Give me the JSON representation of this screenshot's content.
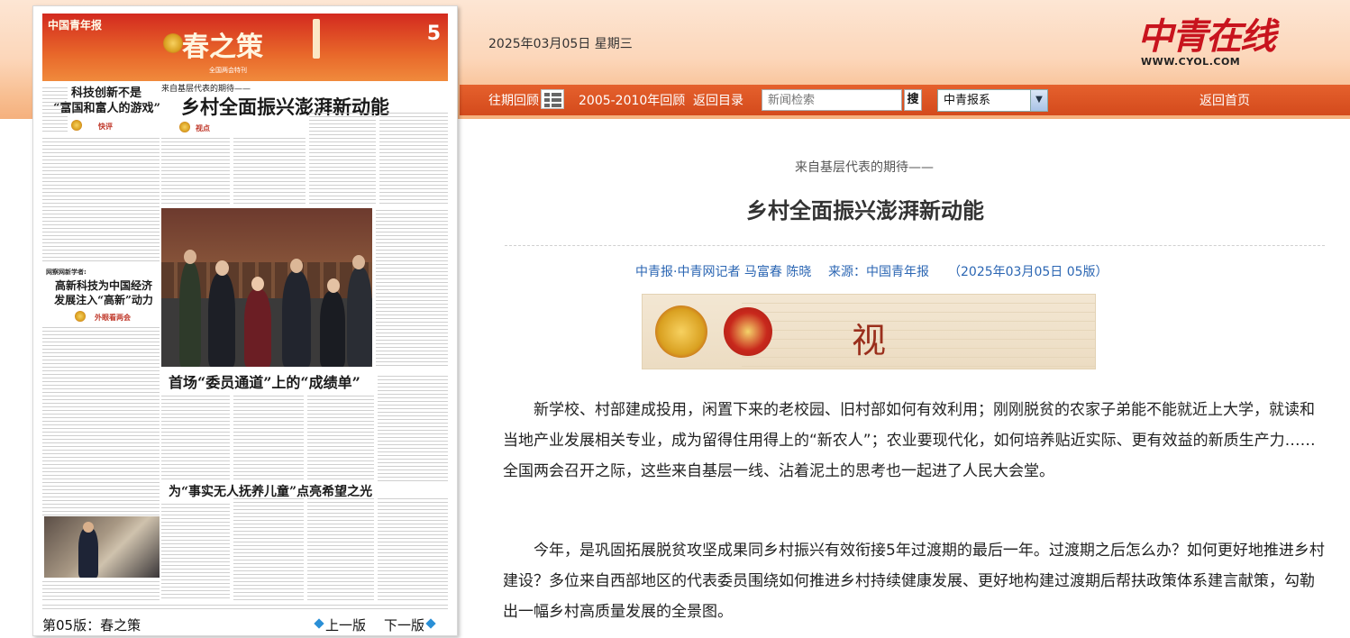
{
  "header": {
    "date": "2025年03月05日 星期三",
    "logo_text": "中青在线",
    "logo_url_text": "WWW.CYOL.COM"
  },
  "nav": {
    "past_review": "往期回顾",
    "archive_2005_2010": "2005-2010年回顾",
    "back_to_index": "返回目录",
    "search_placeholder": "新闻检索",
    "search_button": "搜",
    "paper_select": "中青报系",
    "home": "返回首页"
  },
  "newspaper": {
    "masthead": "中国青年报",
    "section_title": "春之策",
    "page_number": "5",
    "subtitle": "全国两会特刊",
    "headlines": {
      "left_top": "科技创新不是\n“富国和富人的游戏”",
      "left_top_tag": "快评",
      "left_mid_kicker": "网察网新学者:",
      "left_mid": "高新科技为中国经济\n发展注入“高新”动力",
      "left_mid_tag": "外眼看两会",
      "main_kicker": "来自基层代表的期待——",
      "main": "乡村全面振兴澎湃新动能",
      "main_tag": "视点",
      "mid": "首场“委员通道”上的“成绩单”",
      "bottom": "为“事实无人抚养儿童”点亮希望之光"
    },
    "page_label": "第05版：春之策",
    "prev_page": "上一版",
    "next_page": "下一版"
  },
  "article": {
    "kicker": "来自基层代表的期待——",
    "title": "乡村全面振兴澎湃新动能",
    "author": "中青报·中青网记者 马富春 陈晓",
    "source": "来源：中国青年报",
    "edition": "（2025年03月05日 05版）",
    "banner_text": "视 点",
    "paragraphs": [
      "新学校、村部建成投用，闲置下来的老校园、旧村部如何有效利用；刚刚脱贫的农家子弟能不能就近上大学，就读和当地产业发展相关专业，成为留得住用得上的“新农人”；农业要现代化，如何培养贴近实际、更有效益的新质生产力……全国两会召开之际，这些来自基层一线、沾着泥土的思考也一起进了人民大会堂。",
      "今年，是巩固拓展脱贫攻坚成果同乡村振兴有效衔接5年过渡期的最后一年。过渡期之后怎么办？如何更好地推进乡村建设？多位来自西部地区的代表委员围绕如何推进乡村持续健康发展、更好地构建过渡期后帮扶政策体系建言献策，勾勒出一幅乡村高质量发展的全景图。"
    ]
  },
  "colors": {
    "nav_bar": "#d44a1c",
    "link_blue": "#2b66b3",
    "logo_red": "#c8141e"
  }
}
